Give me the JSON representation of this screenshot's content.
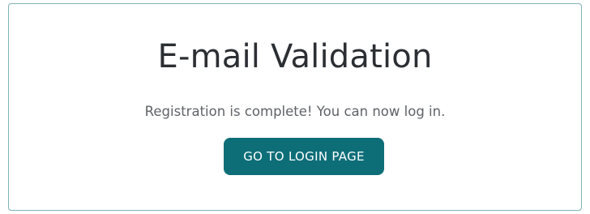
{
  "page": {
    "title": "E-mail Validation",
    "message": "Registration is complete! You can now log in.",
    "login_button_label": "GO TO LOGIN PAGE"
  },
  "colors": {
    "accent": "#0e6e78",
    "card_border": "#7fb3b6",
    "title_text": "#2b2f33",
    "message_text": "#5f6368"
  }
}
